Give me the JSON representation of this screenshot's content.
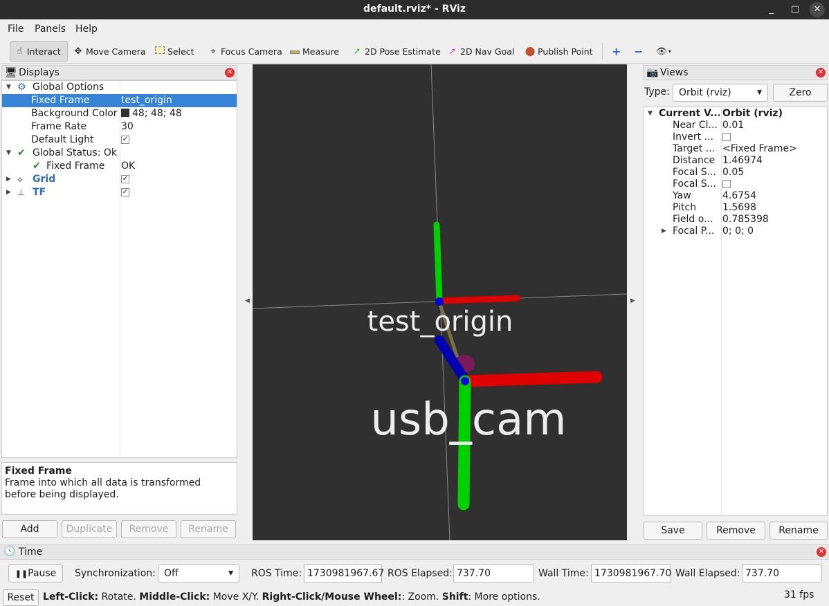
{
  "window": {
    "title": "default.rviz* - RViz",
    "minimize": "_",
    "maximize": "□",
    "close": "✕"
  },
  "menu": {
    "file": "File",
    "panels": "Panels",
    "help": "Help"
  },
  "toolbar": {
    "interact": "Interact",
    "move_camera": "Move Camera",
    "select": "Select",
    "focus_camera": "Focus Camera",
    "measure": "Measure",
    "pose_estimate": "2D Pose Estimate",
    "nav_goal": "2D Nav Goal",
    "publish_point": "Publish Point",
    "icons": [
      "hand-icon",
      "move-camera-icon",
      "select-icon",
      "focus-camera-icon",
      "measure-icon",
      "pose-arrow-icon",
      "nav-arrow-icon",
      "map-pin-icon",
      "add-icon",
      "remove-icon",
      "eye-icon"
    ],
    "colors": {
      "pose": "#2ecc2e",
      "nav": "#e040c8",
      "pin": "#c0522d",
      "plus": "#2b6cc4"
    }
  },
  "displays": {
    "title": "Displays",
    "tree": {
      "global_options": "Global Options",
      "fixed_frame_label": "Fixed Frame",
      "fixed_frame_value": "test_origin",
      "bg_color_label": "Background Color",
      "bg_color_value": "48; 48; 48",
      "frame_rate_label": "Frame Rate",
      "frame_rate_value": "30",
      "default_light_label": "Default Light",
      "default_light_checked": true,
      "global_status_label": "Global Status: Ok",
      "status_fixed_frame_label": "Fixed Frame",
      "status_fixed_frame_value": "OK",
      "grid_label": "Grid",
      "grid_checked": true,
      "tf_label": "TF",
      "tf_checked": true
    },
    "description": {
      "title": "Fixed Frame",
      "body": "Frame into which all data is transformed before being displayed."
    },
    "buttons": {
      "add": "Add",
      "duplicate": "Duplicate",
      "remove": "Remove",
      "rename": "Rename"
    }
  },
  "viewport": {
    "background": "#303030",
    "frames": [
      {
        "name": "test_origin"
      },
      {
        "name": "usb_cam"
      }
    ],
    "axis_colors": {
      "x": "#e00000",
      "y": "#00d000",
      "z": "#0000b0"
    }
  },
  "views": {
    "title": "Views",
    "type_label": "Type:",
    "type_value": "Orbit (rviz)",
    "zero": "Zero",
    "header_key": "Current V...",
    "header_value": "Orbit (rviz)",
    "properties": [
      {
        "key": "Near Cl...",
        "value": "0.01"
      },
      {
        "key": "Invert ...",
        "value": "",
        "checkbox": true
      },
      {
        "key": "Target ...",
        "value": "<Fixed Frame>"
      },
      {
        "key": "Distance",
        "value": "1.46974"
      },
      {
        "key": "Focal S...",
        "value": "0.05"
      },
      {
        "key": "Focal S...",
        "value": "",
        "checkbox": true
      },
      {
        "key": "Yaw",
        "value": "4.6754"
      },
      {
        "key": "Pitch",
        "value": "1.5698"
      },
      {
        "key": "Field o...",
        "value": "0.785398"
      },
      {
        "key": "Focal P...",
        "value": "0; 0; 0",
        "expandable": true
      }
    ],
    "buttons": {
      "save": "Save",
      "remove": "Remove",
      "rename": "Rename"
    }
  },
  "time": {
    "title": "Time",
    "pause": "Pause",
    "sync_label": "Synchronization:",
    "sync_value": "Off",
    "ros_time_label": "ROS Time:",
    "ros_time": "1730981967.67",
    "ros_elapsed_label": "ROS Elapsed:",
    "ros_elapsed": "737.70",
    "wall_time_label": "Wall Time:",
    "wall_time": "1730981967.70",
    "wall_elapsed_label": "Wall Elapsed:",
    "wall_elapsed": "737.70"
  },
  "status": {
    "reset": "Reset",
    "left_click_key": "Left-Click:",
    "left_click_val": " Rotate. ",
    "middle_click_key": "Middle-Click:",
    "middle_click_val": " Move X/Y. ",
    "right_click_key": "Right-Click/Mouse Wheel:",
    "right_click_val": ": Zoom. ",
    "shift_key": "Shift",
    "shift_val": ": More options.",
    "fps": "31 fps"
  }
}
